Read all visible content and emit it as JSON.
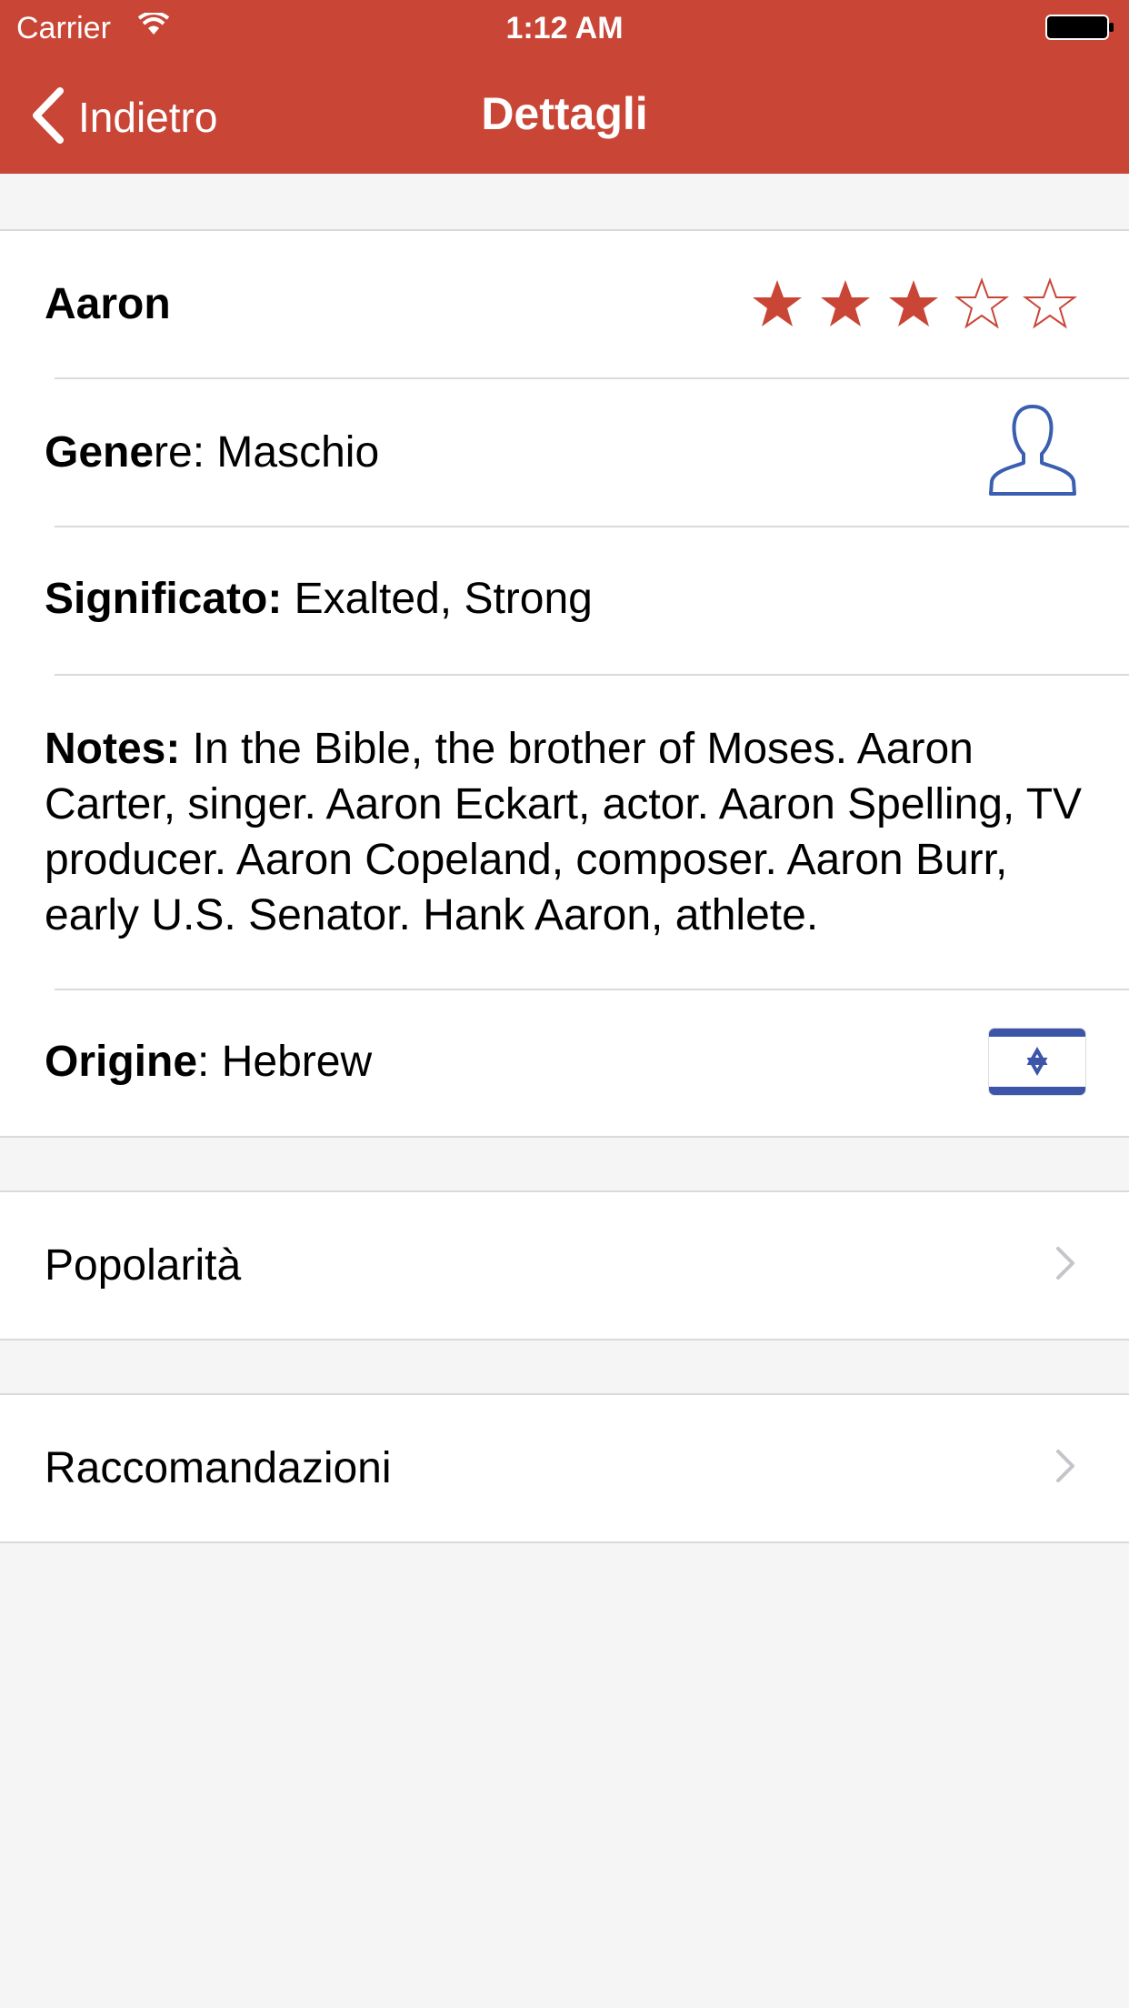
{
  "status_bar": {
    "carrier": "Carrier",
    "time": "1:12 AM"
  },
  "nav": {
    "back_label": "Indietro",
    "title": "Dettagli"
  },
  "details": {
    "name": "Aaron",
    "rating": {
      "value": 3,
      "max": 5,
      "filled_color": "#c94536",
      "empty_color": "#c94536"
    },
    "gender": {
      "label_bold": "Gene",
      "label_rest": "re: ",
      "value": "Maschio",
      "icon": "male-person-icon"
    },
    "meaning": {
      "label": "Significato:",
      "value": " Exalted, Strong"
    },
    "notes": {
      "label": "Notes:",
      "value": " In the Bible, the brother of Moses.  Aaron Carter, singer. Aaron Eckart, actor. Aaron Spelling, TV producer. Aaron Copeland, composer. Aaron Burr, early U.S. Senator. Hank Aaron, athlete."
    },
    "origin": {
      "label": "Origine",
      "value": ": Hebrew",
      "icon": "israel-flag-icon"
    }
  },
  "links": [
    {
      "label": "Popolarità"
    },
    {
      "label": "Raccomandazioni"
    }
  ],
  "colors": {
    "header": "#c94536",
    "accent_blue": "#3a5fb0",
    "background": "#f5f5f5"
  }
}
